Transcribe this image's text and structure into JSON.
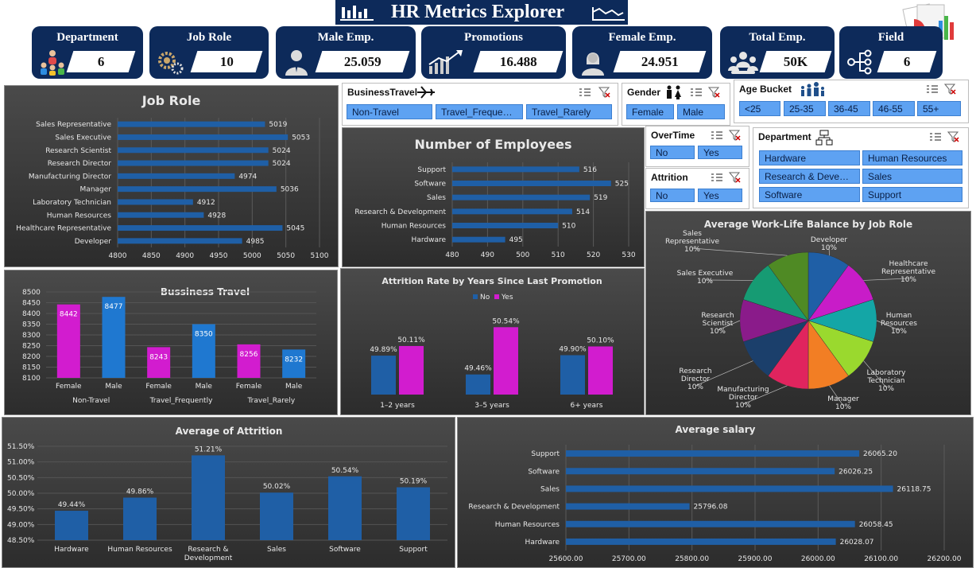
{
  "title": "HR Metrics Explorer",
  "kpis": {
    "department": {
      "label": "Department",
      "value": "6"
    },
    "job_role": {
      "label": "Job Role",
      "value": "10"
    },
    "male_emp": {
      "label": "Male Emp.",
      "value": "25.059"
    },
    "promotions": {
      "label": "Promotions",
      "value": "16.488"
    },
    "female_emp": {
      "label": "Female Emp.",
      "value": "24.951"
    },
    "total_emp": {
      "label": "Total Emp.",
      "value": "50K"
    },
    "field": {
      "label": "Field",
      "value": "6"
    }
  },
  "slicers": {
    "business_travel": {
      "title": "BusinessTravel",
      "items": [
        "Non-Travel",
        "Travel_Freque…",
        "Travel_Rarely"
      ]
    },
    "gender": {
      "title": "Gender",
      "items": [
        "Female",
        "Male"
      ]
    },
    "age_bucket": {
      "title": "Age Bucket",
      "items": [
        "<25",
        "25-35",
        "36-45",
        "46-55",
        "55+"
      ]
    },
    "overtime": {
      "title": "OverTime",
      "items": [
        "No",
        "Yes"
      ]
    },
    "attrition": {
      "title": "Attrition",
      "items": [
        "No",
        "Yes"
      ]
    },
    "department": {
      "title": "Department",
      "items": [
        "Hardware",
        "Human Resources",
        "Research & Deve…",
        "Sales",
        "Software",
        "Support"
      ]
    }
  },
  "colors": {
    "navy": "#0d2a5a",
    "bar_blue": "#1f5fa6",
    "magenta": "#d21ccf",
    "slicer_chip": "#5ea2f2"
  },
  "chart_data": [
    {
      "id": "job_role",
      "type": "bar",
      "orientation": "horizontal",
      "title": "Job Role",
      "categories": [
        "Sales Representative",
        "Sales Executive",
        "Research Scientist",
        "Research Director",
        "Manufacturing Director",
        "Manager",
        "Laboratory Technician",
        "Human Resources",
        "Healthcare Representative",
        "Developer"
      ],
      "values": [
        5019,
        5053,
        5024,
        5024,
        4974,
        5036,
        4912,
        4928,
        5045,
        4985
      ],
      "xlim": [
        4800,
        5100
      ],
      "ticks": [
        "4800",
        "4850",
        "4900",
        "4950",
        "5000",
        "5050",
        "5100"
      ]
    },
    {
      "id": "num_employees",
      "type": "bar",
      "orientation": "horizontal",
      "title": "Number of Employees",
      "categories": [
        "Support",
        "Software",
        "Sales",
        "Research & Development",
        "Human Resources",
        "Hardware"
      ],
      "values": [
        516,
        525,
        519,
        514,
        510,
        495
      ],
      "xlim": [
        480,
        530
      ],
      "ticks": [
        "480",
        "490",
        "500",
        "510",
        "520",
        "530"
      ]
    },
    {
      "id": "business_travel",
      "type": "bar",
      "title": "Bussiness Travel",
      "groups": [
        "Non-Travel",
        "Travel_Frequently",
        "Travel_Rarely"
      ],
      "categories": [
        "Female",
        "Male",
        "Female",
        "Male",
        "Female",
        "Male"
      ],
      "values": [
        8442,
        8477,
        8243,
        8350,
        8256,
        8232
      ],
      "labels": [
        "8442",
        "8477",
        "8243",
        "8350",
        "8256",
        "8232"
      ],
      "ylim": [
        8100,
        8500
      ],
      "ticks": [
        "8100",
        "8150",
        "8200",
        "8250",
        "8300",
        "8350",
        "8400",
        "8450",
        "8500"
      ]
    },
    {
      "id": "attrition_promo",
      "type": "bar",
      "title": "Attrition Rate by Years Since Last Promotion",
      "categories": [
        "1–2 years",
        "3–5 years",
        "6+ years"
      ],
      "series": [
        {
          "name": "No",
          "values": [
            49.89,
            49.46,
            49.9
          ],
          "labels": [
            "49.89%",
            "49.46%",
            "49.90%"
          ]
        },
        {
          "name": "Yes",
          "values": [
            50.11,
            50.54,
            50.1
          ],
          "labels": [
            "50.11%",
            "50.54%",
            "50.10%"
          ]
        }
      ],
      "ylim": [
        49.0,
        50.6
      ]
    },
    {
      "id": "wlb_pie",
      "type": "pie",
      "title": "Average Work-Life Balance by Job Role",
      "categories": [
        "Developer",
        "Healthcare Representative",
        "Human Resources",
        "Laboratory Technician",
        "Manager",
        "Manufacturing Director",
        "Research Director",
        "Research Scientist",
        "Sales Executive",
        "Sales Representative"
      ],
      "values": [
        10,
        10,
        10,
        10,
        10,
        10,
        10,
        10,
        10,
        10
      ],
      "labels": [
        "10%",
        "10%",
        "10%",
        "10%",
        "10%",
        "10%",
        "10%",
        "10%",
        "10%",
        "10%"
      ]
    },
    {
      "id": "avg_attrition",
      "type": "bar",
      "title": "Average of Attrition",
      "categories": [
        "Hardware",
        "Human Resources",
        "Research & Development",
        "Sales",
        "Software",
        "Support"
      ],
      "values": [
        49.44,
        49.86,
        51.21,
        50.02,
        50.54,
        50.19
      ],
      "labels": [
        "49.44%",
        "49.86%",
        "51.21%",
        "50.02%",
        "50.54%",
        "50.19%"
      ],
      "ylim": [
        48.5,
        51.5
      ],
      "ticks": [
        "48.50%",
        "49.00%",
        "49.50%",
        "50.00%",
        "50.50%",
        "51.00%",
        "51.50%"
      ]
    },
    {
      "id": "avg_salary",
      "type": "bar",
      "orientation": "horizontal",
      "title": "Average salary",
      "categories": [
        "Support",
        "Software",
        "Sales",
        "Research & Development",
        "Human Resources",
        "Hardware"
      ],
      "values": [
        26065.2,
        26026.25,
        26118.75,
        25796.08,
        26058.45,
        26028.07
      ],
      "labels": [
        "26065.20",
        "26026.25",
        "26118.75",
        "25796.08",
        "26058.45",
        "26028.07"
      ],
      "xlim": [
        25600,
        26200
      ],
      "ticks": [
        "25600.00",
        "25700.00",
        "25800.00",
        "25900.00",
        "26000.00",
        "26100.00",
        "26200.00"
      ]
    }
  ]
}
